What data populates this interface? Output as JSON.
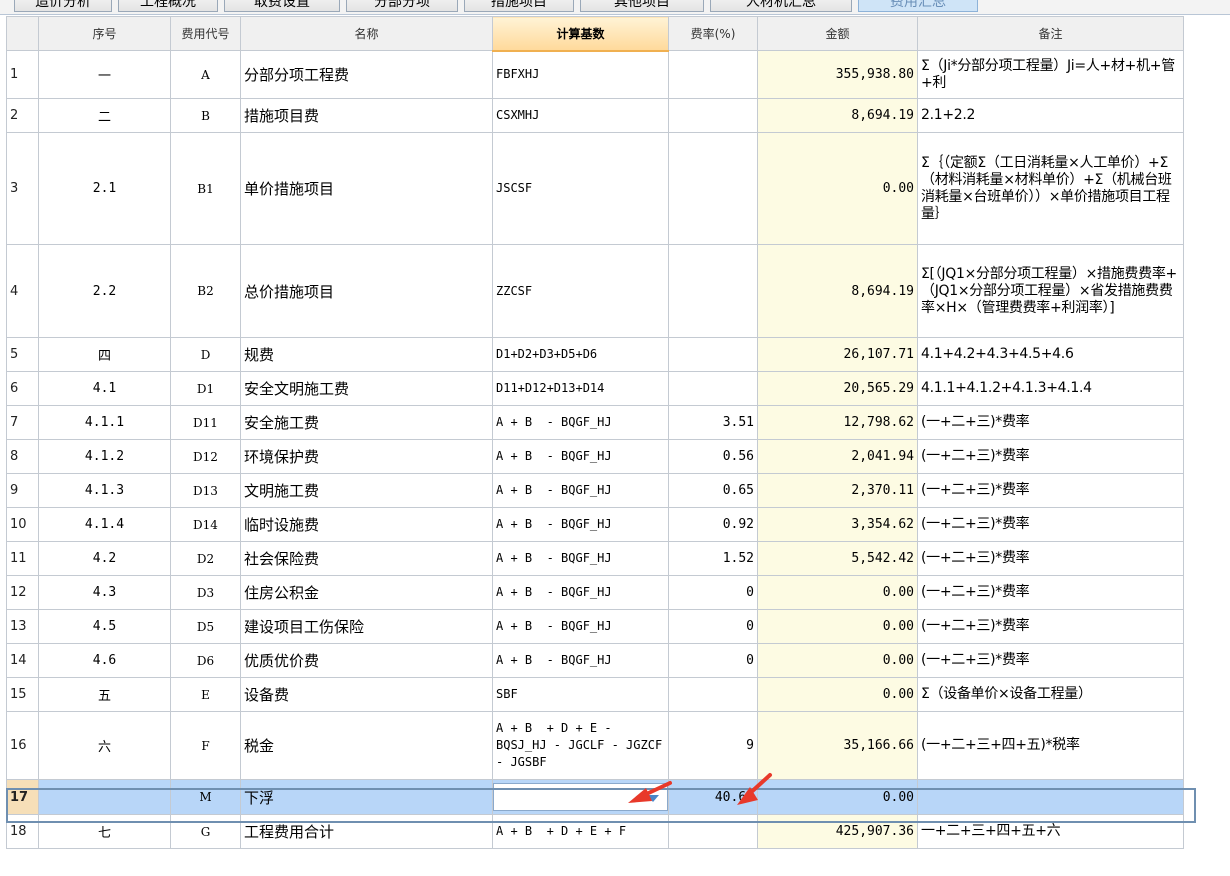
{
  "tabs": [
    {
      "label": "造价分析",
      "active": false
    },
    {
      "label": "工程概况",
      "active": false
    },
    {
      "label": "取费设置",
      "active": false
    },
    {
      "label": "分部分项",
      "active": false
    },
    {
      "label": "措施项目",
      "active": false
    },
    {
      "label": "其他项目",
      "active": false
    },
    {
      "label": "人材机汇总",
      "active": false
    },
    {
      "label": "费用汇总",
      "active": true
    }
  ],
  "columns": {
    "seq": "序号",
    "code": "费用代号",
    "name": "名称",
    "base": "计算基数",
    "rate": "费率(%)",
    "amount": "金额",
    "note": "备注"
  },
  "rows": [
    {
      "n": "1",
      "seq": "一",
      "code": "A",
      "name": "分部分项工程费",
      "base": "FBFXHJ",
      "rate": "",
      "amount": "355,938.80",
      "note": "Σ（Ji*分部分项工程量）Ji=人+材+机+管+利"
    },
    {
      "n": "2",
      "seq": "二",
      "code": "B",
      "name": "措施项目费",
      "base": "CSXMHJ",
      "rate": "",
      "amount": "8,694.19",
      "note": "2.1+2.2"
    },
    {
      "n": "3",
      "seq": "2.1",
      "code": "B1",
      "name": "单价措施项目",
      "base": "JSCSF",
      "rate": "",
      "amount": "0.00",
      "note": "Σ｛（定额Σ（工日消耗量×人工单价）+Σ（材料消耗量×材料单价）+Σ（机械台班消耗量×台班单价））×单价措施项目工程量｝"
    },
    {
      "n": "4",
      "seq": "2.2",
      "code": "B2",
      "name": "总价措施项目",
      "base": "ZZCSF",
      "rate": "",
      "amount": "8,694.19",
      "note": "Σ[（JQ1×分部分项工程量）×措施费费率+（JQ1×分部分项工程量）×省发措施费费率×H×（管理费费率+利润率）]"
    },
    {
      "n": "5",
      "seq": "四",
      "code": "D",
      "name": "规费",
      "base": "D1+D2+D3+D5+D6",
      "rate": "",
      "amount": "26,107.71",
      "note": "4.1+4.2+4.3+4.5+4.6"
    },
    {
      "n": "6",
      "seq": "4.1",
      "code": "D1",
      "name": "安全文明施工费",
      "base": "D11+D12+D13+D14",
      "rate": "",
      "amount": "20,565.29",
      "note": "4.1.1+4.1.2+4.1.3+4.1.4"
    },
    {
      "n": "7",
      "seq": "4.1.1",
      "code": "D11",
      "name": "安全施工费",
      "base": "A + B  - BQGF_HJ",
      "rate": "3.51",
      "amount": "12,798.62",
      "note": "(一+二+三)*费率"
    },
    {
      "n": "8",
      "seq": "4.1.2",
      "code": "D12",
      "name": "环境保护费",
      "base": "A + B  - BQGF_HJ",
      "rate": "0.56",
      "amount": "2,041.94",
      "note": "(一+二+三)*费率"
    },
    {
      "n": "9",
      "seq": "4.1.3",
      "code": "D13",
      "name": "文明施工费",
      "base": "A + B  - BQGF_HJ",
      "rate": "0.65",
      "amount": "2,370.11",
      "note": "(一+二+三)*费率"
    },
    {
      "n": "10",
      "seq": "4.1.4",
      "code": "D14",
      "name": "临时设施费",
      "base": "A + B  - BQGF_HJ",
      "rate": "0.92",
      "amount": "3,354.62",
      "note": "(一+二+三)*费率"
    },
    {
      "n": "11",
      "seq": "4.2",
      "code": "D2",
      "name": "社会保险费",
      "base": "A + B  - BQGF_HJ",
      "rate": "1.52",
      "amount": "5,542.42",
      "note": "(一+二+三)*费率"
    },
    {
      "n": "12",
      "seq": "4.3",
      "code": "D3",
      "name": "住房公积金",
      "base": "A + B  - BQGF_HJ",
      "rate": "0",
      "amount": "0.00",
      "note": "(一+二+三)*费率"
    },
    {
      "n": "13",
      "seq": "4.5",
      "code": "D5",
      "name": "建设项目工伤保险",
      "base": "A + B  - BQGF_HJ",
      "rate": "0",
      "amount": "0.00",
      "note": "(一+二+三)*费率"
    },
    {
      "n": "14",
      "seq": "4.6",
      "code": "D6",
      "name": "优质优价费",
      "base": "A + B  - BQGF_HJ",
      "rate": "0",
      "amount": "0.00",
      "note": "(一+二+三)*费率"
    },
    {
      "n": "15",
      "seq": "五",
      "code": "E",
      "name": "设备费",
      "base": "SBF",
      "rate": "",
      "amount": "0.00",
      "note": "Σ（设备单价×设备工程量）"
    },
    {
      "n": "16",
      "seq": "六",
      "code": "F",
      "name": "税金",
      "base": "A + B  + D + E - BQSJ_HJ - JGCLF - JGZCF - JGSBF",
      "rate": "9",
      "amount": "35,166.66",
      "note": "(一+二+三+四+五)*税率"
    },
    {
      "n": "17",
      "seq": "",
      "code": "M",
      "name": "下浮",
      "base": "",
      "rate": "40.67",
      "amount": "0.00",
      "note": "",
      "selected": true
    },
    {
      "n": "18",
      "seq": "七",
      "code": "G",
      "name": "工程费用合计",
      "base": "A + B  + D + E + F",
      "rate": "",
      "amount": "425,907.36",
      "note": "一+二+三+四+五+六"
    }
  ],
  "colors": {
    "accent": "#4a86c8",
    "annotation_arrow": "#e8392a",
    "selected_row": "#b8d6f8"
  }
}
